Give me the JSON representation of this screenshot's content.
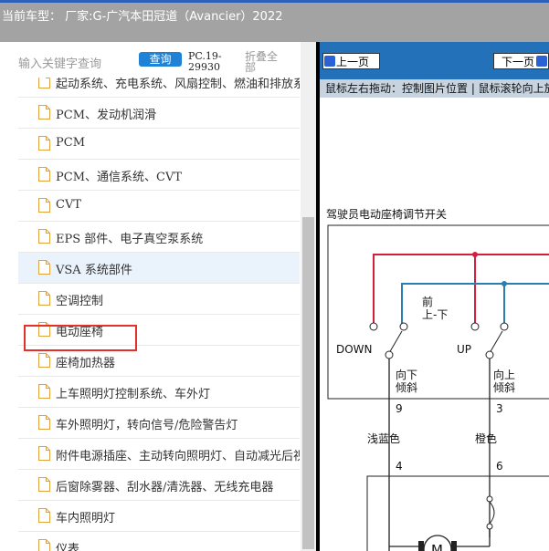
{
  "header": {
    "vehicle_title": "当前车型： 厂家:G-广汽本田冠道（Avancier）2022"
  },
  "search": {
    "placeholder": "输入关键字查询",
    "query_button": "查询",
    "code": "PC.19-29930",
    "collapse_all": "折叠全部"
  },
  "tree": {
    "items": [
      {
        "label": "起动系统、充电系统、风扇控制、燃油和排放系统"
      },
      {
        "label": "PCM、发动机润滑"
      },
      {
        "label": "PCM"
      },
      {
        "label": "PCM、通信系统、CVT"
      },
      {
        "label": "CVT"
      },
      {
        "label": "EPS 部件、电子真空泵系统"
      },
      {
        "label": "VSA 系统部件"
      },
      {
        "label": "空调控制"
      },
      {
        "label": "电动座椅"
      },
      {
        "label": "座椅加热器"
      },
      {
        "label": "上车照明灯控制系统、车外灯"
      },
      {
        "label": "车外照明灯，转向信号/危险警告灯"
      },
      {
        "label": "附件电源插座、主动转向照明灯、自动减光后视镜"
      },
      {
        "label": "后窗除雾器、刮水器/清洗器、无线充电器"
      },
      {
        "label": "车内照明灯"
      },
      {
        "label": "仪表"
      }
    ],
    "selected_index": 6,
    "highlighted_index": 8
  },
  "viewer": {
    "prev_label": "上一页",
    "next_label": "下一页",
    "hint": "鼠标左右拖动：控制图片位置 | 鼠标滚轮向上放大"
  },
  "diagram": {
    "title": "驾驶员电动座椅调节开关",
    "front_label_1": "前",
    "front_label_2": "上-下",
    "down_label": "DOWN",
    "up_label": "UP",
    "left_tilt_1": "向下",
    "left_tilt_2": "倾斜",
    "right_tilt_1": "向上",
    "right_tilt_2": "倾斜",
    "pin_left_top": "9",
    "pin_right_top": "3",
    "wire_left": "浅蓝色",
    "wire_right": "橙色",
    "pin_left_bottom": "4",
    "pin_right_bottom": "6",
    "motor_label": "M",
    "colors": {
      "red_wire": "#d21f3c",
      "blue_wire": "#2a7fb0"
    }
  }
}
